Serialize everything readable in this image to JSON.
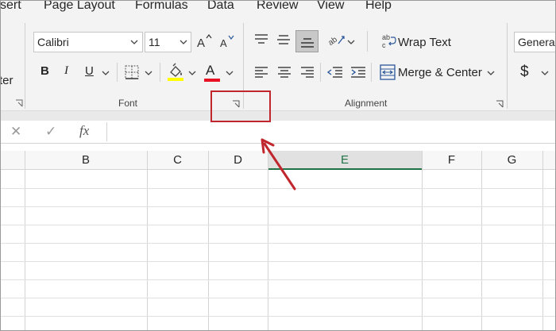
{
  "ribbon_tabs": [
    "sert",
    "Page Layout",
    "Formulas",
    "Data",
    "Review",
    "View",
    "Help"
  ],
  "left_cut_label": "ter",
  "font_group": {
    "font_name": "Calibri",
    "font_size": "11",
    "grow_icon": "A^",
    "shrink_icon": "A˅",
    "bold": "B",
    "italic": "I",
    "underline": "U",
    "font_color_letter": "A",
    "label": "Font"
  },
  "alignment_group": {
    "wrap_text": "Wrap Text",
    "merge_center": "Merge & Center",
    "label": "Alignment"
  },
  "number_group": {
    "format": "General",
    "currency": "$"
  },
  "formula_bar": {
    "cancel": "✕",
    "enter": "✓",
    "function": "fx"
  },
  "columns": [
    {
      "label": "B",
      "selected": false
    },
    {
      "label": "C",
      "selected": false
    },
    {
      "label": "D",
      "selected": false
    },
    {
      "label": "E",
      "selected": true
    },
    {
      "label": "F",
      "selected": false
    },
    {
      "label": "G",
      "selected": false
    }
  ],
  "colors": {
    "highlight": "#c0262c",
    "excel_green": "#217346",
    "fill_yellow": "#ffff00",
    "font_red": "#e81123"
  }
}
